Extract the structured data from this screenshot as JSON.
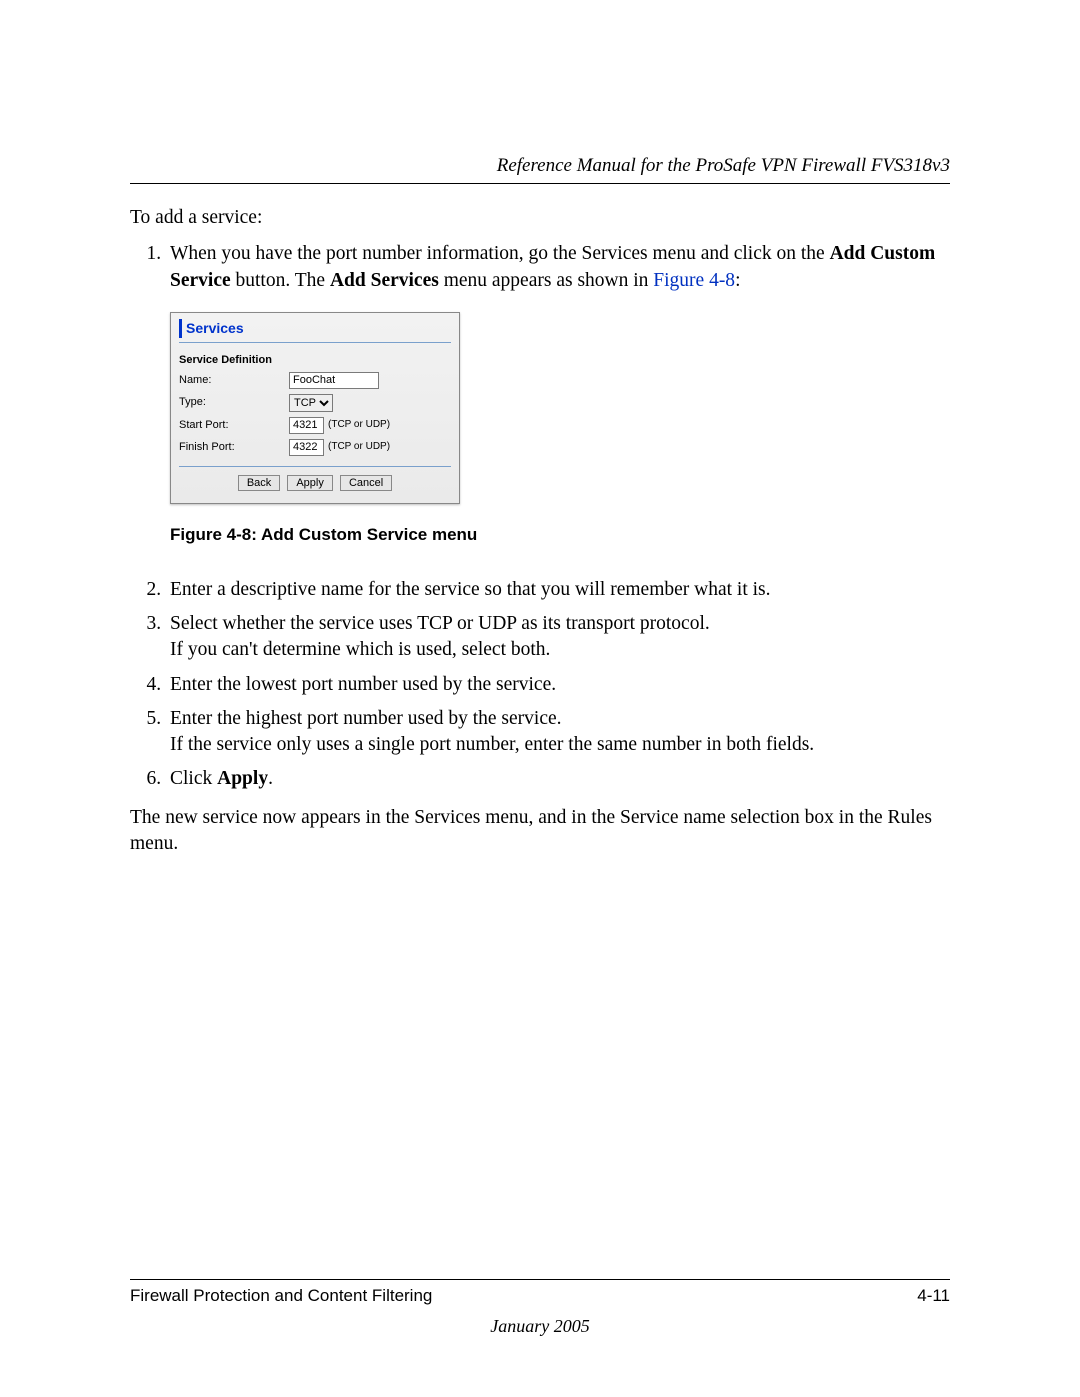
{
  "header": {
    "title": "Reference Manual for the ProSafe VPN Firewall FVS318v3"
  },
  "intro": "To add a service:",
  "step1": {
    "pre": "When you have the port number information, go the Services menu and click on the ",
    "bold1": "Add Custom Service",
    "mid": " button. The ",
    "bold2": "Add Services",
    "post": " menu appears as shown in ",
    "link": "Figure 4-8",
    "colon": ":"
  },
  "panel": {
    "title": "Services",
    "section_label": "Service Definition",
    "rows": {
      "name_label": "Name:",
      "name_value": "FooChat",
      "type_label": "Type:",
      "type_value": "TCP",
      "start_label": "Start Port:",
      "start_value": "4321",
      "finish_label": "Finish Port:",
      "finish_value": "4322",
      "port_note": "(TCP or UDP)"
    },
    "buttons": {
      "back": "Back",
      "apply": "Apply",
      "cancel": "Cancel"
    }
  },
  "figure_caption": "Figure 4-8:  Add Custom Service menu",
  "step2": "Enter a descriptive name for the service so that you will remember what it is.",
  "step3_line1": "Select whether the service uses TCP or UDP as its transport protocol.",
  "step3_line2": "If you can't determine which is used, select both.",
  "step4": "Enter the lowest port number used by the service.",
  "step5_line1": "Enter the highest port number used by the service.",
  "step5_line2": "If the service only uses a single port number, enter the same number in both fields.",
  "step6_pre": "Click ",
  "step6_bold": "Apply",
  "step6_post": ".",
  "after": "The new service now appears in the Services menu, and in the Service name selection box in the Rules menu.",
  "footer": {
    "left": "Firewall Protection and Content Filtering",
    "right": "4-11",
    "date": "January 2005"
  }
}
